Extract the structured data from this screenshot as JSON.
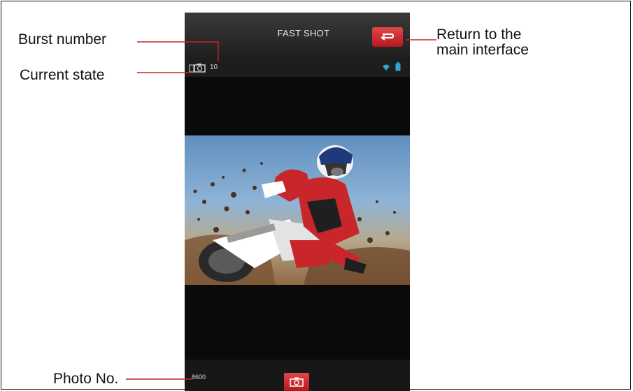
{
  "app": {
    "title": "FAST SHOT"
  },
  "status": {
    "burst_number": "10",
    "icons": [
      "camera-burst-icon",
      "wifi-icon",
      "battery-icon"
    ]
  },
  "footer": {
    "photo_count": "8600",
    "shutter_icon": "camera-icon"
  },
  "callouts": {
    "burst_number": "Burst number",
    "current_state": "Current state",
    "return_line1": "Return to the",
    "return_line2": "main interface",
    "photo_no": "Photo No."
  },
  "colors": {
    "accent_red": "#c8262a",
    "leader_red": "#c0262c",
    "status_blue": "#2aa6d6"
  }
}
